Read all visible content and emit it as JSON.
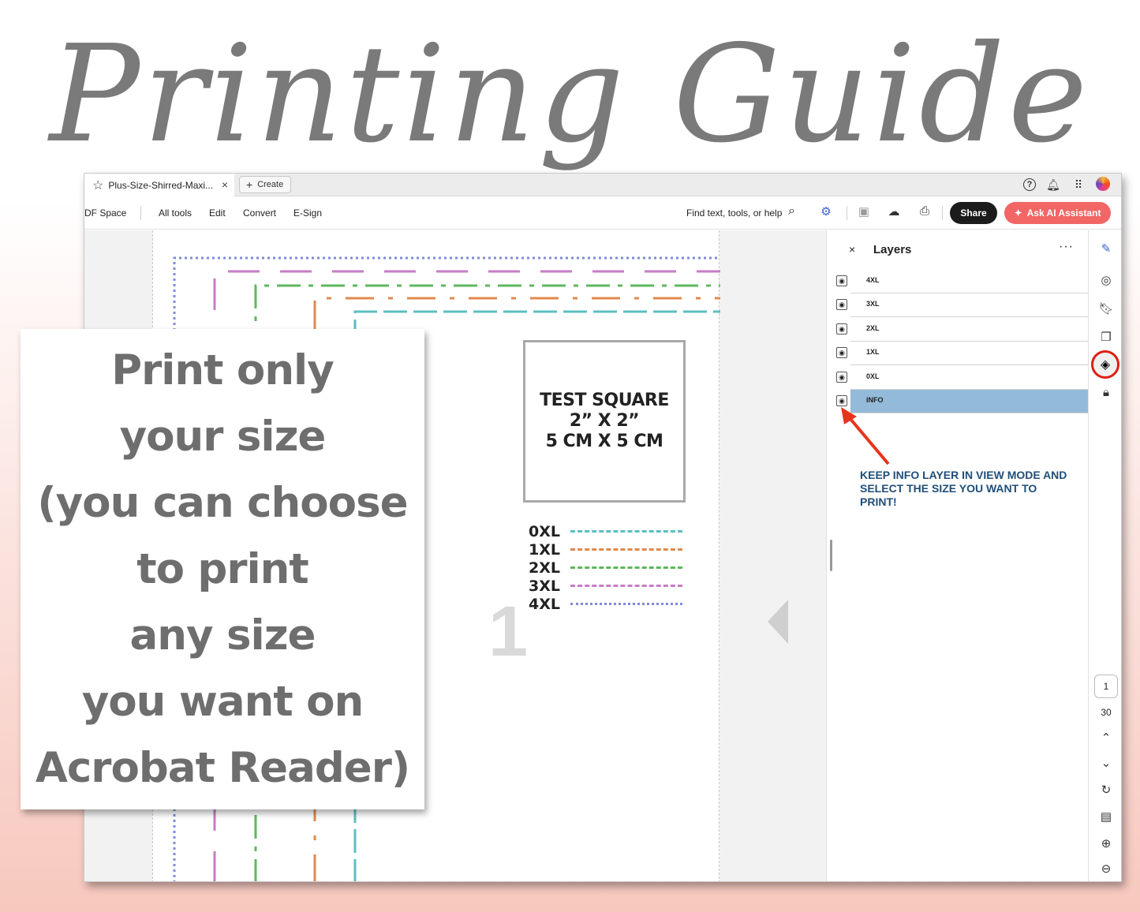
{
  "title": "Printing Guide",
  "window": {
    "tab_title": "Plus-Size-Shirred-Maxi...",
    "tab_close": "×",
    "create_label": "Create",
    "toolbar": {
      "space": "DF Space",
      "all_tools": "All tools",
      "edit": "Edit",
      "convert": "Convert",
      "esign": "E-Sign",
      "find": "Find text, tools, or help",
      "share": "Share",
      "ask_ai": "Ask AI Assistant"
    }
  },
  "document": {
    "test_square": [
      "TEST SQUARE",
      "2” X 2”",
      "5 CM X 5 CM"
    ],
    "legend": [
      {
        "label": "0XL",
        "color": "#5bbfc2"
      },
      {
        "label": "1XL",
        "color": "#e08a4c"
      },
      {
        "label": "2XL",
        "color": "#5cb85c"
      },
      {
        "label": "3XL",
        "color": "#c77dc7"
      },
      {
        "label": "4XL",
        "color": "#7f8cd6"
      }
    ]
  },
  "layers_panel": {
    "title": "Layers",
    "more": "···",
    "close": "×",
    "layers": [
      {
        "name": "4XL",
        "selected": false
      },
      {
        "name": "3XL",
        "selected": false
      },
      {
        "name": "2XL",
        "selected": false
      },
      {
        "name": "1XL",
        "selected": false
      },
      {
        "name": "0XL",
        "selected": false
      },
      {
        "name": "INFO",
        "selected": true
      }
    ],
    "note": "KEEP INFO LAYER IN VIEW MODE AND SELECT THE SIZE YOU WANT TO PRINT!"
  },
  "rail": {
    "page_current": "1",
    "page_total": "30"
  },
  "card": {
    "lines": [
      "Print only",
      "your size",
      "(you can choose",
      "to print",
      "any size",
      "you want on",
      "Acrobat Reader)"
    ]
  },
  "colors": {
    "accent_red": "#f26666",
    "highlight_blue": "#93bbd9",
    "note_blue": "#1f4e79"
  }
}
